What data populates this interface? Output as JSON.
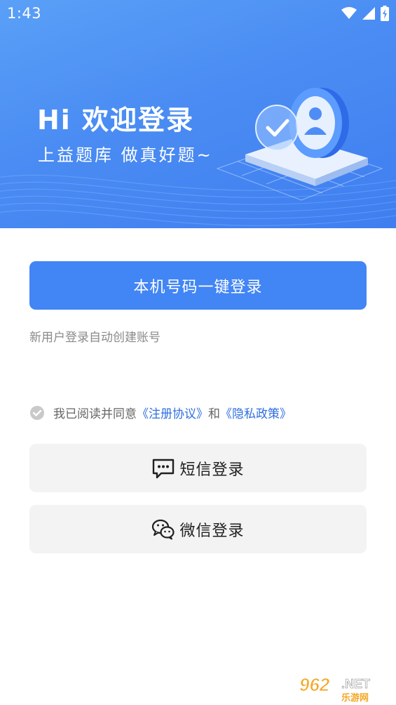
{
  "status_bar": {
    "time": "1:43",
    "icons": [
      "wifi-icon",
      "signal-icon",
      "battery-charging-icon"
    ]
  },
  "hero": {
    "title": "Hi 欢迎登录",
    "subtitle": "上益题库  做真好题~",
    "illustration": "user-verified-illustration"
  },
  "login": {
    "one_click_label": "本机号码一键登录",
    "hint": "新用户登录自动创建账号"
  },
  "agreement": {
    "prefix": "我已阅读并同意",
    "terms": "《注册协议》",
    "and": "和",
    "privacy": "《隐私政策》",
    "checked": true
  },
  "sms_login": {
    "label": "短信登录",
    "icon": "sms-icon"
  },
  "wechat_login": {
    "label": "微信登录",
    "icon": "wechat-icon"
  },
  "colors": {
    "primary": "#4285f4",
    "link": "#2f6fe0",
    "secondary_bg": "#f3f3f4"
  },
  "watermark": {
    "brand": "962",
    "suffix": ".NET",
    "cn": "乐游网"
  }
}
